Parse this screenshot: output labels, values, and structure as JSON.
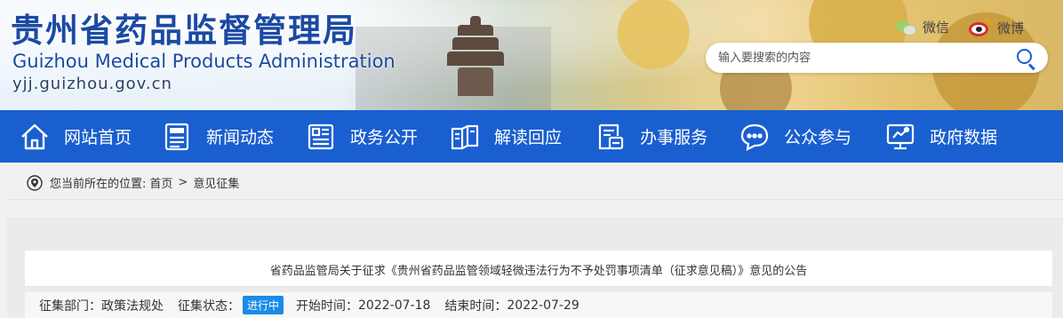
{
  "header": {
    "title_cn": "贵州省药品监督管理局",
    "title_en": "Guizhou Medical Products Administration",
    "domain": "yjj.guizhou.gov.cn",
    "wechat_label": "微信",
    "weibo_label": "微博",
    "search_placeholder": "输入要搜索的内容"
  },
  "nav": {
    "items": [
      {
        "label": "网站首页",
        "icon": "home-icon"
      },
      {
        "label": "新闻动态",
        "icon": "news-icon"
      },
      {
        "label": "政务公开",
        "icon": "document-icon"
      },
      {
        "label": "解读回应",
        "icon": "book-icon"
      },
      {
        "label": "办事服务",
        "icon": "service-icon"
      },
      {
        "label": "公众参与",
        "icon": "chat-icon"
      },
      {
        "label": "政府数据",
        "icon": "data-icon"
      }
    ],
    "color": "#1a5fd0"
  },
  "breadcrumb": {
    "prefix": "您当前所在的位置:",
    "home": "首页",
    "separator": ">",
    "current": "意见征集"
  },
  "article": {
    "title": "省药品监管局关于征求《贵州省药品监管领域轻微违法行为不予处罚事项清单（征求意见稿）》意见的公告",
    "dept_label": "征集部门：",
    "dept_value": "政策法规处",
    "status_label": "征集状态：",
    "status_value": "进行中",
    "start_label": "开始时间：",
    "start_value": "2022-07-18",
    "end_label": "结束时间：",
    "end_value": "2022-07-29"
  }
}
